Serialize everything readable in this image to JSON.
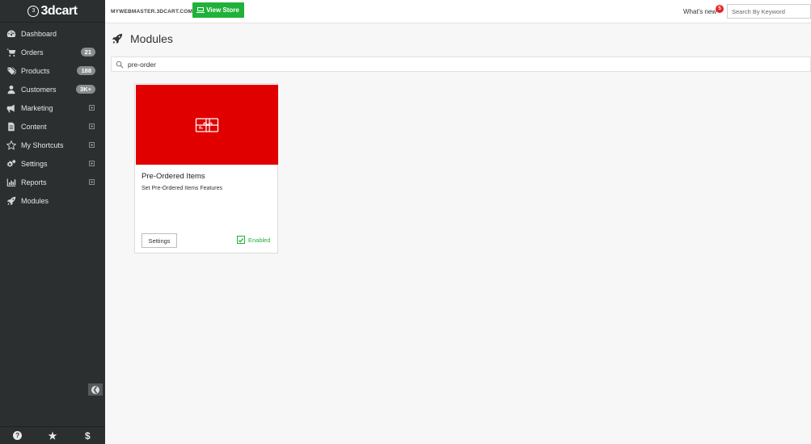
{
  "brand": {
    "name": "3dcart",
    "logo_glyph": "3"
  },
  "topbar": {
    "store_url": "MYWEBMASTER.3DCART.COM",
    "view_store_label": "View Store",
    "whats_new_label": "What's new",
    "notification_count": "5",
    "search_placeholder": "Search By Keyword",
    "accent_green": "#1fb23a",
    "notification_red": "#e4242b"
  },
  "sidebar": {
    "items": [
      {
        "label": "Dashboard",
        "icon": "dashboard-icon"
      },
      {
        "label": "Orders",
        "icon": "cart-icon",
        "badge": "21"
      },
      {
        "label": "Products",
        "icon": "tags-icon",
        "badge": "188"
      },
      {
        "label": "Customers",
        "icon": "user-icon",
        "badge": "3K+"
      },
      {
        "label": "Marketing",
        "icon": "bullhorn-icon",
        "expandable": true
      },
      {
        "label": "Content",
        "icon": "document-icon",
        "expandable": true
      },
      {
        "label": "My Shortcuts",
        "icon": "star-icon",
        "expandable": true
      },
      {
        "label": "Settings",
        "icon": "gears-icon",
        "expandable": true
      },
      {
        "label": "Reports",
        "icon": "bar-chart-icon",
        "expandable": true
      },
      {
        "label": "Modules",
        "icon": "rocket-icon"
      }
    ],
    "footer": {
      "help_glyph": "?",
      "favorites_glyph": "★",
      "billing_glyph": "$",
      "collapse_glyph": "❮"
    },
    "background": "#2c2f30"
  },
  "main": {
    "page_title": "Modules",
    "search_value": "pre-order",
    "module_card": {
      "title": "Pre-Ordered Items",
      "description": "Set Pre-Ordered Items Features",
      "settings_label": "Settings",
      "enabled_label": "Enabled",
      "enabled": true,
      "banner_color": "#e10000",
      "banner_icon": "gift-card-icon"
    }
  }
}
